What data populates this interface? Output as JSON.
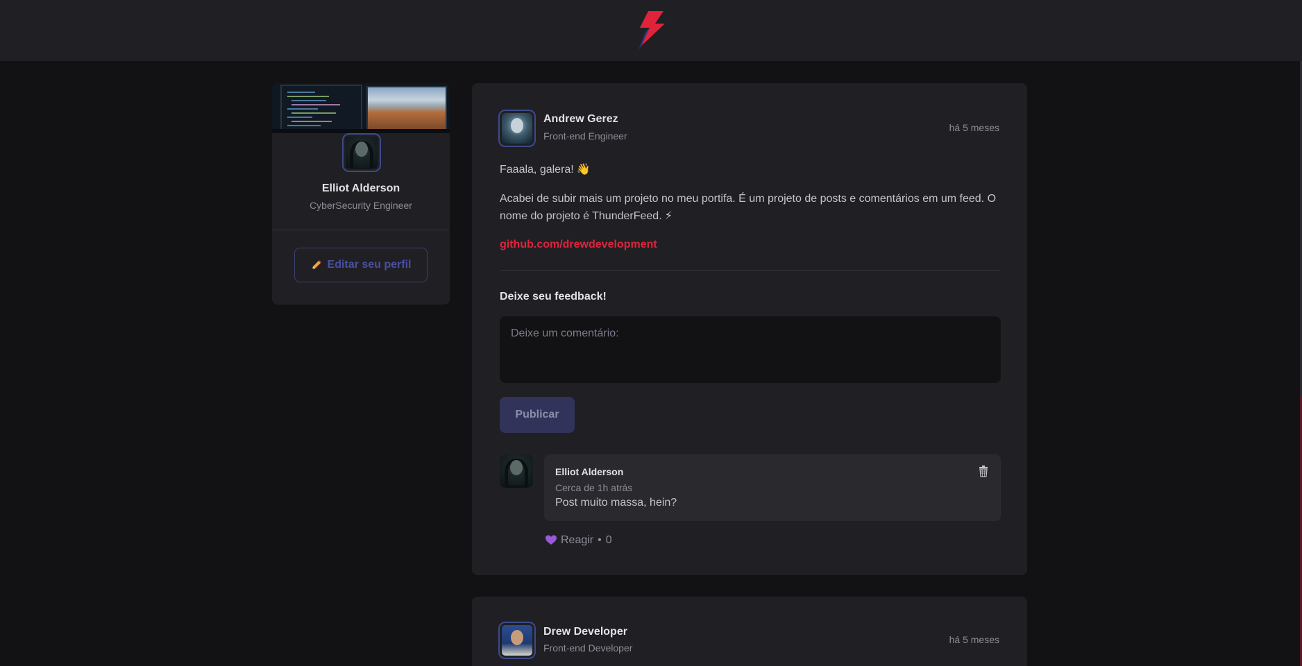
{
  "colors": {
    "background": "#121214",
    "surface": "#202024",
    "accent_red": "#e0233b",
    "accent_blue": "#2b3680",
    "button_bg": "#31335a",
    "text": "#e1e1e6",
    "muted": "#8d8d99"
  },
  "header": {
    "logo_icon": "thunder-bolt-icon"
  },
  "sidebar": {
    "user_name": "Elliot Alderson",
    "user_role": "CyberSecurity Engineer",
    "edit_button_label": "Editar seu perfil",
    "edit_icon": "pencil-icon"
  },
  "posts": [
    {
      "author": {
        "name": "Andrew Gerez",
        "role": "Front-end Engineer"
      },
      "published": "há 5 meses",
      "content": {
        "greeting": "Faaala, galera!",
        "greeting_emoji": "👋",
        "body": "Acabei de subir mais um projeto no meu portifa. É um projeto de posts e comentários em um feed. O nome do projeto é ThunderFeed.",
        "body_emoji": "⚡",
        "link": "github.com/drewdevelopment"
      },
      "feedback_title": "Deixe seu feedback!",
      "comment_placeholder": "Deixe um comentário:",
      "publish_label": "Publicar",
      "comments": [
        {
          "author": "Elliot Alderson",
          "time": "Cerca de 1h atrás",
          "text": "Post muito massa, hein?",
          "react_label": "Reagir",
          "separator": "•",
          "react_count": "0"
        }
      ]
    },
    {
      "author": {
        "name": "Drew Developer",
        "role": "Front-end Developer"
      },
      "published": "há 5 meses"
    }
  ]
}
